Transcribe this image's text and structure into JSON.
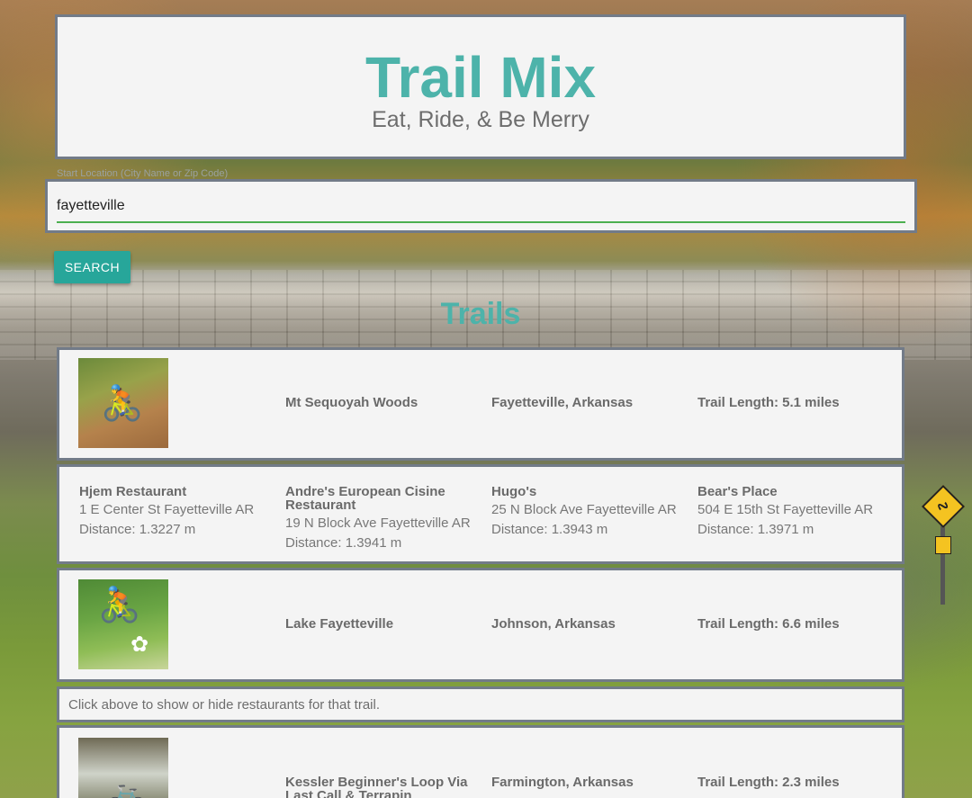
{
  "app": {
    "title": "Trail Mix",
    "subtitle": "Eat, Ride, & Be Merry"
  },
  "search": {
    "label": "Start Location (City Name or Zip Code)",
    "value": "fayetteville",
    "button_label": "SEARCH"
  },
  "section_title": "Trails",
  "trails": [
    {
      "name": "Mt Sequoyah Woods",
      "location": "Fayetteville, Arkansas",
      "length": "Trail Length: 5.1 miles"
    },
    {
      "name": "Lake Fayetteville",
      "location": "Johnson, Arkansas",
      "length": "Trail Length: 6.6 miles"
    },
    {
      "name": "Kessler Beginner's Loop Via Last Call & Terrapin",
      "location": "Farmington, Arkansas",
      "length": "Trail Length: 2.3 miles"
    }
  ],
  "restaurants": [
    {
      "name": "Hjem Restaurant",
      "address": "1 E Center St Fayetteville AR",
      "distance": "Distance: 1.3227 m"
    },
    {
      "name": "Andre's European Cisine Restaurant",
      "address": "19 N Block Ave Fayetteville AR",
      "distance": "Distance: 1.3941 m"
    },
    {
      "name": "Hugo's",
      "address": "25 N Block Ave Fayetteville AR",
      "distance": "Distance: 1.3943 m"
    },
    {
      "name": "Bear's Place",
      "address": "504 E 15th St Fayetteville AR",
      "distance": "Distance: 1.3971 m"
    }
  ],
  "hint_text": "Click above to show or hide restaurants for that trail.",
  "colors": {
    "accent": "#4db3aa",
    "button": "#27a69a",
    "card_bg": "#f4f4f4",
    "border": "#727b88",
    "input_underline": "#4caf50"
  }
}
